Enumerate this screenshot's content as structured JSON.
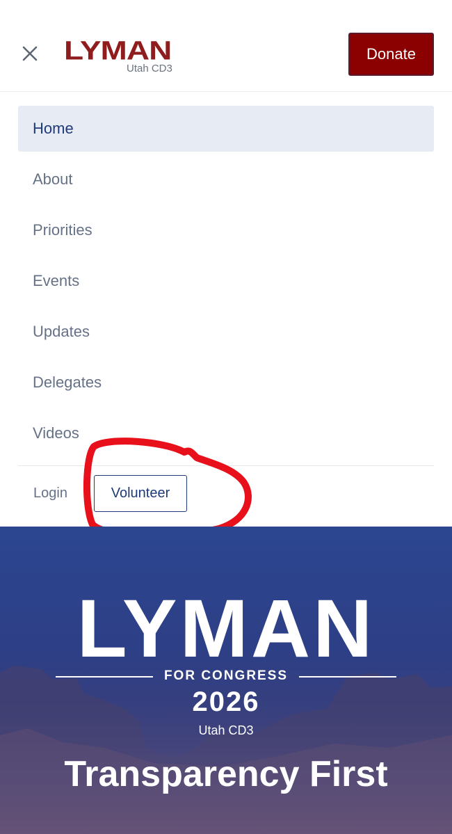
{
  "header": {
    "logo_text": "LYMAN",
    "logo_sub": "Utah CD3",
    "donate_label": "Donate",
    "colors": {
      "brand_red": "#8b0000",
      "brand_blue": "#1e3a7b"
    }
  },
  "nav": {
    "items": [
      {
        "label": "Home",
        "active": true
      },
      {
        "label": "About"
      },
      {
        "label": "Priorities"
      },
      {
        "label": "Events"
      },
      {
        "label": "Updates"
      },
      {
        "label": "Delegates"
      },
      {
        "label": "Videos"
      }
    ]
  },
  "footer_links": {
    "login_label": "Login",
    "volunteer_label": "Volunteer"
  },
  "hero": {
    "title": "LYMAN",
    "subtitle": "FOR CONGRESS",
    "year": "2026",
    "district": "Utah CD3",
    "tagline": "Transparency First"
  }
}
